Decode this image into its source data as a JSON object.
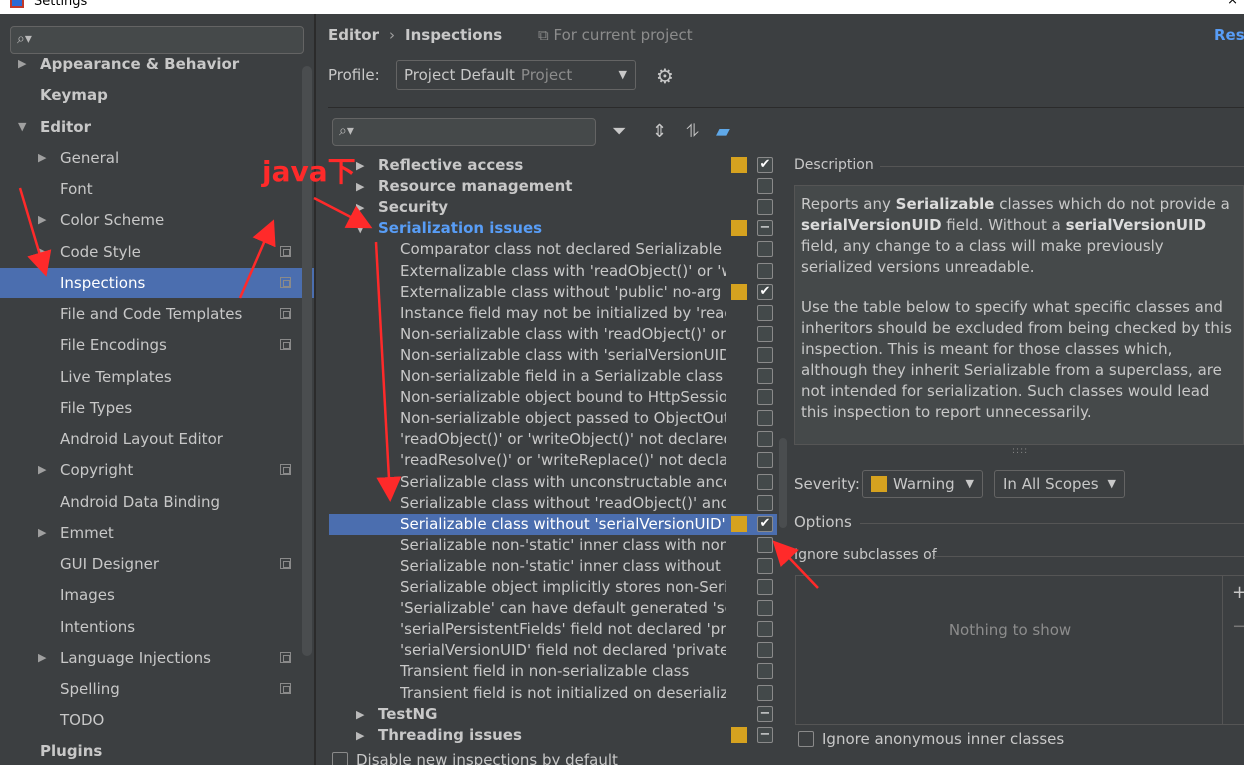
{
  "window": {
    "title": "Settings",
    "close_glyph": "×"
  },
  "sidebar": {
    "search": {
      "placeholder": "",
      "icon": "search-icon"
    },
    "items": [
      {
        "label": "Appearance & Behavior",
        "arrow": "▶",
        "bold": true
      },
      {
        "label": "Keymap",
        "arrow": "",
        "bold": true
      },
      {
        "label": "Editor",
        "arrow": "▼",
        "bold": true
      },
      {
        "label": "General",
        "arrow": "▶"
      },
      {
        "label": "Font",
        "arrow": ""
      },
      {
        "label": "Color Scheme",
        "arrow": "▶"
      },
      {
        "label": "Code Style",
        "arrow": "▶",
        "copy": true
      },
      {
        "label": "Inspections",
        "arrow": "",
        "copy": true,
        "selected": true
      },
      {
        "label": "File and Code Templates",
        "arrow": "",
        "copy": true
      },
      {
        "label": "File Encodings",
        "arrow": "",
        "copy": true
      },
      {
        "label": "Live Templates",
        "arrow": ""
      },
      {
        "label": "File Types",
        "arrow": ""
      },
      {
        "label": "Android Layout Editor",
        "arrow": ""
      },
      {
        "label": "Copyright",
        "arrow": "▶",
        "copy": true
      },
      {
        "label": "Android Data Binding",
        "arrow": ""
      },
      {
        "label": "Emmet",
        "arrow": "▶"
      },
      {
        "label": "GUI Designer",
        "arrow": "",
        "copy": true
      },
      {
        "label": "Images",
        "arrow": ""
      },
      {
        "label": "Intentions",
        "arrow": ""
      },
      {
        "label": "Language Injections",
        "arrow": "▶",
        "copy": true
      },
      {
        "label": "Spelling",
        "arrow": "",
        "copy": true
      },
      {
        "label": "TODO",
        "arrow": ""
      },
      {
        "label": "Plugins",
        "arrow": "",
        "bold": true
      }
    ]
  },
  "header": {
    "breadcrumb": [
      "Editor",
      "Inspections"
    ],
    "breadcrumb_sep": "›",
    "scope_hint": "⧉ For current project",
    "reset_label": "Rese"
  },
  "profile": {
    "label": "Profile:",
    "value": "Project Default",
    "sub": "Project",
    "dropdown_glyph": "▼",
    "gear_icon": "gear-icon"
  },
  "inspections": {
    "search_placeholder": "",
    "toolbar_icons": [
      "filter-icon",
      "expand-all-icon",
      "collapse-all-icon",
      "eraser-icon"
    ],
    "rows": [
      {
        "label": "Reflective access",
        "type": "group",
        "arrow": "▶",
        "severity": true,
        "check": "✔"
      },
      {
        "label": "Resource management",
        "type": "group",
        "arrow": "▶",
        "severity": false,
        "check": ""
      },
      {
        "label": "Security",
        "type": "group",
        "arrow": "▶",
        "severity": false,
        "check": ""
      },
      {
        "label": "Serialization issues",
        "type": "group",
        "arrow": "▼",
        "severity": true,
        "check": "−",
        "highlight": true
      },
      {
        "label": "Comparator class not declared Serializable",
        "type": "child",
        "severity": false,
        "check": ""
      },
      {
        "label": "Externalizable class with 'readObject()' or 'writeObject()'",
        "type": "child",
        "severity": false,
        "check": ""
      },
      {
        "label": "Externalizable class without 'public' no-arg constructor",
        "type": "child",
        "severity": true,
        "check": "✔"
      },
      {
        "label": "Instance field may not be initialized by 'readObject()'",
        "type": "child",
        "severity": false,
        "check": ""
      },
      {
        "label": "Non-serializable class with 'readObject()' or 'writeObject()'",
        "type": "child",
        "severity": false,
        "check": ""
      },
      {
        "label": "Non-serializable class with 'serialVersionUID'",
        "type": "child",
        "severity": false,
        "check": ""
      },
      {
        "label": "Non-serializable field in a Serializable class",
        "type": "child",
        "severity": false,
        "check": ""
      },
      {
        "label": "Non-serializable object bound to HttpSession",
        "type": "child",
        "severity": false,
        "check": ""
      },
      {
        "label": "Non-serializable object passed to ObjectOutputStream",
        "type": "child",
        "severity": false,
        "check": ""
      },
      {
        "label": "'readObject()' or 'writeObject()' not declared 'private'",
        "type": "child",
        "severity": false,
        "check": ""
      },
      {
        "label": "'readResolve()' or 'writeReplace()' not declared 'protected'",
        "type": "child",
        "severity": false,
        "check": ""
      },
      {
        "label": "Serializable class with unconstructable ancestor",
        "type": "child",
        "severity": false,
        "check": ""
      },
      {
        "label": "Serializable class without 'readObject()' and 'writeObject()'",
        "type": "child",
        "severity": false,
        "check": ""
      },
      {
        "label": "Serializable class without 'serialVersionUID'",
        "type": "child",
        "severity": true,
        "check": "✔",
        "selected": true
      },
      {
        "label": "Serializable non-'static' inner class with non-Serializable outer class",
        "type": "child",
        "severity": false,
        "check": ""
      },
      {
        "label": "Serializable non-'static' inner class without 'serialVersionUID'",
        "type": "child",
        "severity": false,
        "check": ""
      },
      {
        "label": "Serializable object implicitly stores non-Serializable object",
        "type": "child",
        "severity": false,
        "check": ""
      },
      {
        "label": "'Serializable' can have default generated 'serialVersionUID'",
        "type": "child",
        "severity": false,
        "check": ""
      },
      {
        "label": "'serialPersistentFields' field not declared 'private static final'",
        "type": "child",
        "severity": false,
        "check": ""
      },
      {
        "label": "'serialVersionUID' field not declared 'private static final long'",
        "type": "child",
        "severity": false,
        "check": ""
      },
      {
        "label": "Transient field in non-serializable class",
        "type": "child",
        "severity": false,
        "check": ""
      },
      {
        "label": "Transient field is not initialized on deserialization",
        "type": "child",
        "severity": false,
        "check": ""
      },
      {
        "label": "TestNG",
        "type": "group",
        "arrow": "▶",
        "severity": false,
        "check": "−"
      },
      {
        "label": "Threading issues",
        "type": "group",
        "arrow": "▶",
        "severity": true,
        "check": "−"
      }
    ],
    "bottom_checkbox_label": "Disable new inspections by default"
  },
  "description": {
    "title": "Description",
    "para1": [
      "Reports any ",
      "Serializable",
      " classes which do not provide a ",
      "serialVersionUID",
      " field. Without a ",
      "serialVersionUID",
      " field, any change to a class will make previously serialized versions unreadable."
    ],
    "para2": "Use the table below to specify what specific classes and inheritors should be excluded from being checked by this inspection. This is meant for those classes which, although they inherit Serializable from a superclass, are not intended for serialization. Such classes would lead this inspection to report unnecessarily.",
    "grip": "::::"
  },
  "severity": {
    "label": "Severity:",
    "value": "Warning",
    "scope": "In All Scopes",
    "dropdown_glyph": "▼"
  },
  "options": {
    "title": "Options",
    "ignore_subclasses_label": "Ignore subclasses of",
    "empty_text": "Nothing to show",
    "add_glyph": "+",
    "remove_glyph": "−",
    "ignore_anonymous_label": "Ignore anonymous inner classes"
  },
  "annotation": {
    "text": "java下",
    "color": "#ff2a2a"
  }
}
